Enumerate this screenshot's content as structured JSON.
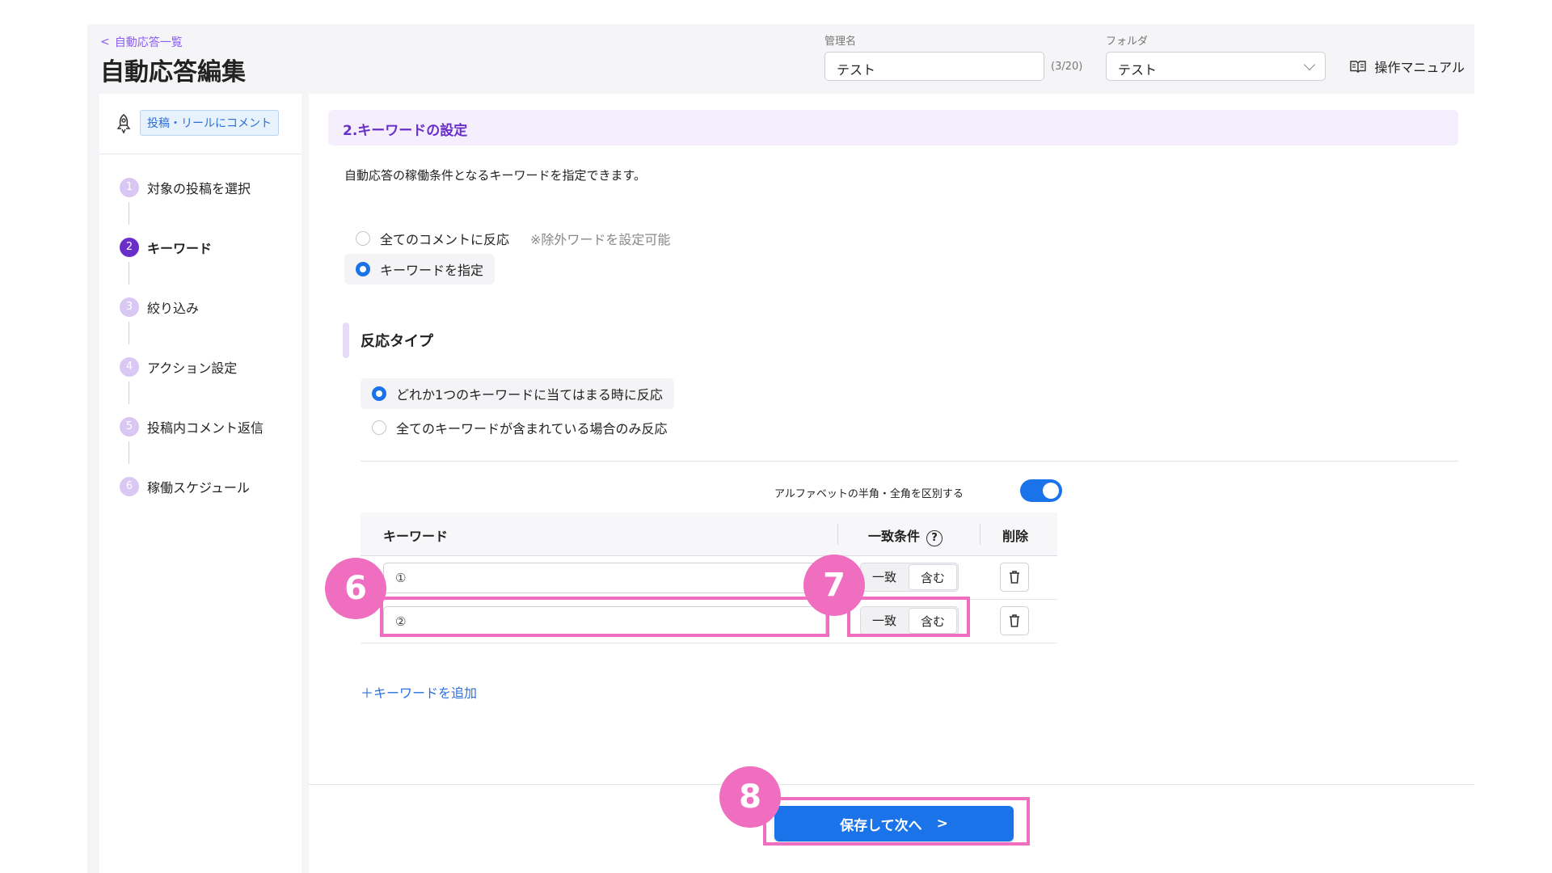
{
  "header": {
    "back_link": "自動応答一覧",
    "title": "自動応答編集",
    "name_label": "管理名",
    "name_value": "テスト",
    "name_counter": "(3/20)",
    "folder_label": "フォルダ",
    "folder_value": "テスト",
    "manual_label": "操作マニュアル"
  },
  "sidebar": {
    "type_badge": "投稿・リールにコメント",
    "steps": [
      {
        "num": "1",
        "label": "対象の投稿を選択"
      },
      {
        "num": "2",
        "label": "キーワード"
      },
      {
        "num": "3",
        "label": "絞り込み"
      },
      {
        "num": "4",
        "label": "アクション設定"
      },
      {
        "num": "5",
        "label": "投稿内コメント返信"
      },
      {
        "num": "6",
        "label": "稼働スケジュール"
      }
    ],
    "active_step": 2
  },
  "main": {
    "section_title": "2.キーワードの設定",
    "description": "自動応答の稼働条件となるキーワードを指定できます。",
    "options": [
      {
        "label": "全てのコメントに反応",
        "hint": "※除外ワードを設定可能",
        "selected": false
      },
      {
        "label": "キーワードを指定",
        "selected": true
      }
    ],
    "reaction_title": "反応タイプ",
    "reaction_options": [
      {
        "label": "どれか1つのキーワードに当てはまる時に反応",
        "selected": true
      },
      {
        "label": "全てのキーワードが含まれている場合のみ反応",
        "selected": false
      }
    ],
    "toggle_label": "アルファベットの半角・全角を区別する",
    "toggle_on": true,
    "table": {
      "col_keyword": "キーワード",
      "col_condition": "一致条件",
      "col_delete": "削除",
      "help_symbol": "?",
      "rows": [
        {
          "placeholder": "①",
          "opt_exact": "一致",
          "opt_contains": "含む",
          "selected": "含む"
        },
        {
          "placeholder": "②",
          "opt_exact": "一致",
          "opt_contains": "含む",
          "selected": "含む"
        }
      ]
    },
    "add_keyword": "＋キーワードを追加",
    "next_button": "保存して次へ",
    "next_chevron": ">"
  },
  "annotations": {
    "marker_6": "6",
    "marker_7": "7",
    "marker_8": "8",
    "color": "#f06ec0"
  },
  "colors": {
    "accent_purple": "#6a2fc9",
    "primary_blue": "#1a73e8"
  }
}
